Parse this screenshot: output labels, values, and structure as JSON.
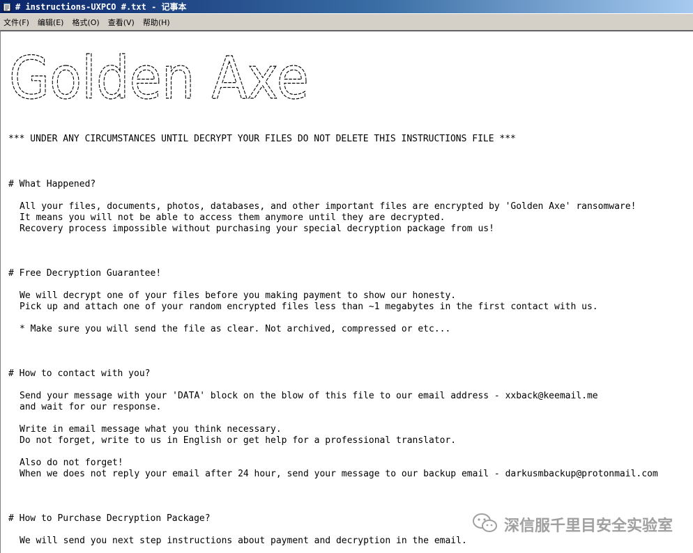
{
  "window": {
    "title": "# instructions-UXPCO #.txt - 记事本"
  },
  "menu": {
    "items": [
      "文件(F)",
      "编辑(E)",
      "格式(O)",
      "查看(V)",
      "帮助(H)"
    ]
  },
  "document": {
    "logo_text": "Golden Axe",
    "warning": "*** UNDER ANY CIRCUMSTANCES UNTIL DECRYPT YOUR FILES DO NOT DELETE THIS INSTRUCTIONS FILE ***",
    "what_happened": {
      "heading": "# What Happened?",
      "lines": [
        "All your files, documents, photos, databases, and other important files are encrypted by 'Golden Axe' ransomware!",
        "It means you will not be able to access them anymore until they are decrypted.",
        "Recovery process impossible without purchasing your special decryption package from us!"
      ]
    },
    "free_decryption": {
      "heading": "# Free Decryption Guarantee!",
      "lines": [
        "We will decrypt one of your files before you making payment to show our honesty.",
        "Pick up and attach one of your random encrypted files less than ~1 megabytes in the first contact with us."
      ],
      "note": "* Make sure you will send the file as clear. Not archived, compressed or etc..."
    },
    "contact": {
      "heading": "# How to contact with you?",
      "line1": "Send your message with your 'DATA' block on the blow of this file to our email address - xxback@keemail.me",
      "line2": "and wait for our response.",
      "line3": "Write in email message what you think necessary.",
      "line4": "Do not forget, write to us in English or get help for a professional translator.",
      "line5": "Also do not forget!",
      "line6": "When we does not reply your email after 24 hour, send your message to our backup email - darkusmbackup@protonmail.com"
    },
    "purchase": {
      "heading": "# How to Purchase Decryption Package?",
      "line1": "We will send you next step instructions about payment and decryption in the email."
    }
  },
  "watermark": {
    "text": "深信服千里目安全实验室",
    "icon": "wechat-icon"
  }
}
